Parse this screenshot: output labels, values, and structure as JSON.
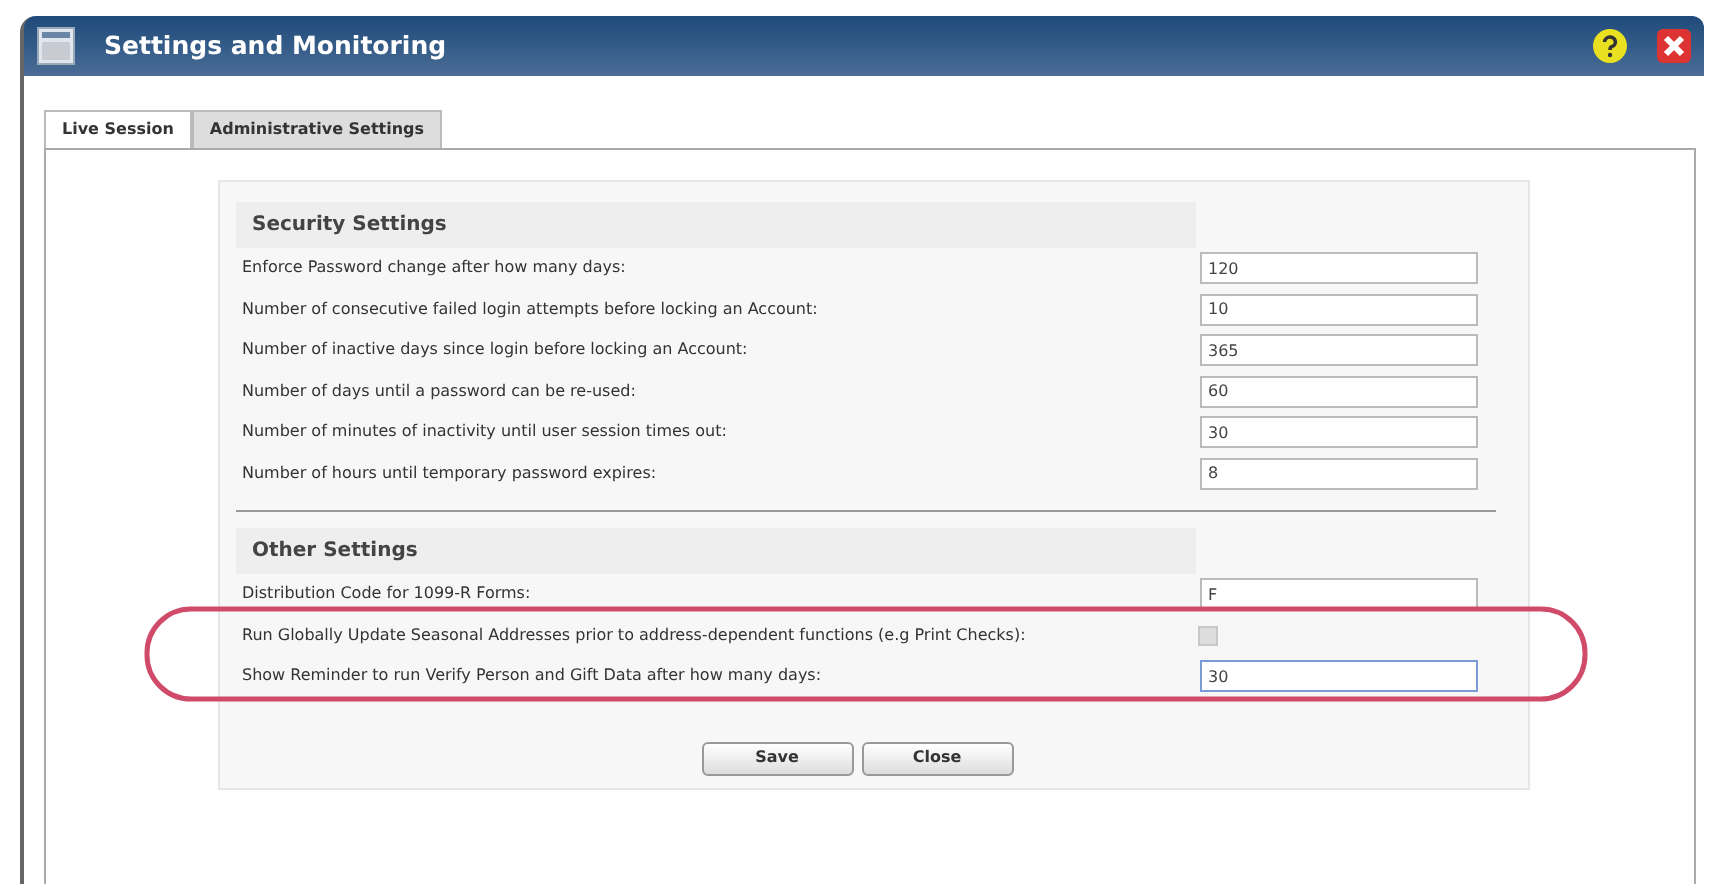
{
  "window": {
    "title": "Settings and Monitoring"
  },
  "tabs": [
    {
      "label": "Live Session",
      "selected": false
    },
    {
      "label": "Administrative Settings",
      "selected": true
    }
  ],
  "sections": [
    {
      "title": "Security Settings",
      "rows": [
        {
          "kind": "text",
          "label": "Enforce Password change after how many days:",
          "value": "120",
          "focused": false
        },
        {
          "kind": "text",
          "label": "Number of consecutive failed login attempts before locking an Account:",
          "value": "10",
          "focused": false
        },
        {
          "kind": "text",
          "label": "Number of inactive days since login before locking an Account:",
          "value": "365",
          "focused": false
        },
        {
          "kind": "text",
          "label": "Number of days until a password can be re-used:",
          "value": "60",
          "focused": false
        },
        {
          "kind": "text",
          "label": "Number of minutes of inactivity until user session times out:",
          "value": "30",
          "focused": false
        },
        {
          "kind": "text",
          "label": "Number of hours until temporary password expires:",
          "value": "8",
          "focused": false
        }
      ]
    },
    {
      "title": "Other Settings",
      "rows": [
        {
          "kind": "text",
          "label": "Distribution Code for 1099-R Forms:",
          "value": "F",
          "focused": false
        },
        {
          "kind": "checkbox",
          "label": "Run Globally Update Seasonal Addresses prior to address-dependent functions (e.g Print Checks):",
          "checked": false,
          "disabled": true
        },
        {
          "kind": "text",
          "label": "Show Reminder to run Verify Person and Gift Data after how many days:",
          "value": "30",
          "focused": true
        }
      ]
    }
  ],
  "buttons": [
    "Save",
    "Close"
  ]
}
